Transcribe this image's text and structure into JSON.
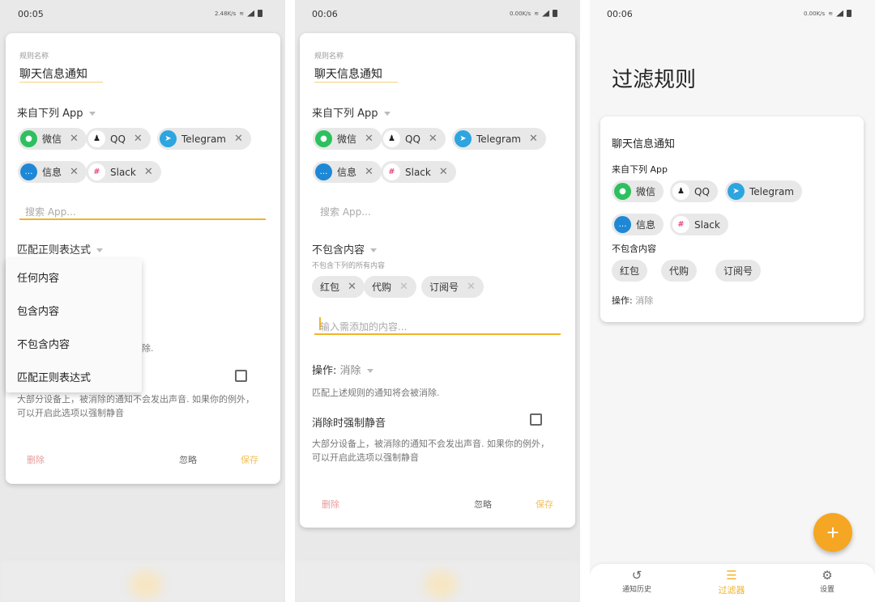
{
  "colors": {
    "accent": "#f0b429",
    "fab": "#f5a623",
    "delete": "#e57373",
    "wechat": "#2dc05f",
    "qq": "#222222",
    "telegram": "#2ca5e0",
    "messages": "#1e88d6",
    "slack": "#e01e5a"
  },
  "apps": [
    {
      "label": "微信",
      "icon": "wechat-icon"
    },
    {
      "label": "QQ",
      "icon": "qq-penguin-icon"
    },
    {
      "label": "Telegram",
      "icon": "telegram-icon"
    },
    {
      "label": "信息",
      "icon": "messages-icon"
    },
    {
      "label": "Slack",
      "icon": "slack-icon"
    }
  ],
  "keywords": [
    "红包",
    "代购",
    "订阅号"
  ],
  "screen1": {
    "status": {
      "time": "00:05",
      "speed": "2.48K/s"
    },
    "rule_name_label": "规则名称",
    "rule_name": "聊天信息通知",
    "apps_header": "来自下列 App",
    "search_placeholder": "搜索 App...",
    "match_mode": "匹配正则表达式",
    "menu": [
      "任何内容",
      "包含内容",
      "不包含内容",
      "匹配正则表达式"
    ],
    "hidden_fragment": "除.",
    "mute_desc": [
      "大部分设备上，被消除的通知不会发出声音. 如果你的例外，",
      "可以开启此选项以强制静音"
    ],
    "delete": "删除",
    "ignore": "忽略",
    "save": "保存"
  },
  "screen2": {
    "status": {
      "time": "00:06",
      "speed": "0.00K/s"
    },
    "rule_name_label": "规则名称",
    "rule_name": "聊天信息通知",
    "apps_header": "来自下列 App",
    "search_placeholder": "搜索 App...",
    "match_mode": "不包含内容",
    "match_sub": "不包含下列的所有内容",
    "keyword_placeholder": "输入需添加的内容...",
    "action_label": "操作:",
    "action_value": "消除",
    "action_desc": "匹配上述规则的通知将会被消除.",
    "mute_label": "消除时强制静音",
    "mute_checked": false,
    "mute_desc": [
      "大部分设备上，被消除的通知不会发出声音. 如果你的例外，",
      "可以开启此选项以强制静音"
    ],
    "delete": "删除",
    "ignore": "忽略",
    "save": "保存"
  },
  "screen3": {
    "status": {
      "time": "00:06",
      "speed": "0.00K/s"
    },
    "title": "过滤规则",
    "rule": {
      "name": "聊天信息通知",
      "apps_header": "来自下列 App",
      "match_mode": "不包含内容",
      "action_label": "操作:",
      "action_value": "消除"
    },
    "fab": "+",
    "nav": [
      {
        "label": "通知历史",
        "icon": "history-icon"
      },
      {
        "label": "过滤器",
        "icon": "filter-icon",
        "active": true
      },
      {
        "label": "设置",
        "icon": "gear-icon"
      }
    ]
  }
}
